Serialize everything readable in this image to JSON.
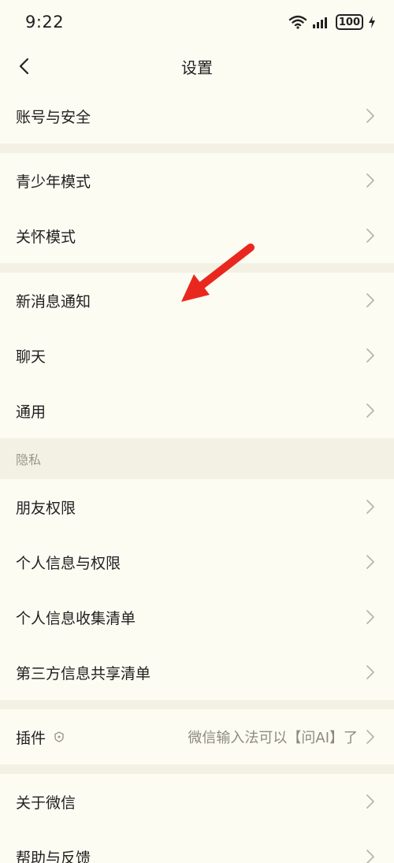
{
  "status_bar": {
    "time": "9:22",
    "battery": "100"
  },
  "header": {
    "title": "设置"
  },
  "groups": [
    {
      "items": [
        {
          "label": "账号与安全"
        }
      ]
    },
    {
      "items": [
        {
          "label": "青少年模式"
        },
        {
          "label": "关怀模式"
        }
      ]
    },
    {
      "items": [
        {
          "label": "新消息通知"
        },
        {
          "label": "聊天"
        },
        {
          "label": "通用"
        }
      ]
    }
  ],
  "privacy": {
    "header": "隐私",
    "items": [
      {
        "label": "朋友权限"
      },
      {
        "label": "个人信息与权限"
      },
      {
        "label": "个人信息收集清单"
      },
      {
        "label": "第三方信息共享清单"
      }
    ]
  },
  "plugins": {
    "label": "插件",
    "value": "微信输入法可以【问AI】了"
  },
  "about": {
    "items": [
      {
        "label": "关于微信"
      },
      {
        "label": "帮助与反馈"
      }
    ]
  },
  "annotation": {
    "color": "#e8281e",
    "icon": "red-arrow-pointer"
  },
  "colors": {
    "background": "#f7f6ec",
    "row_bg": "#fdfcf3",
    "chevron": "#b8b6ac"
  }
}
